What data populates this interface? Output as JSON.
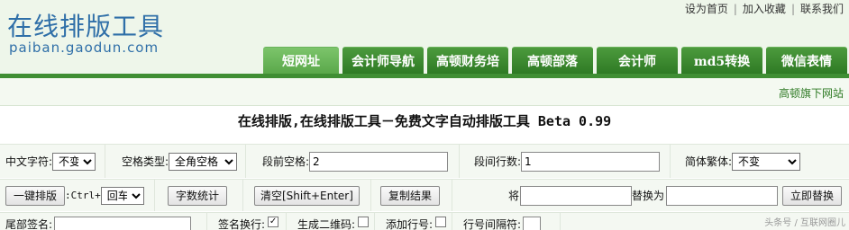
{
  "header": {
    "logo_cn": "在线排版工具",
    "logo_en": "paiban.gaodun.com",
    "top_links": [
      "设为首页",
      "加入收藏",
      "联系我们"
    ],
    "nav_tabs": [
      "短网址",
      "会计师导航",
      "高顿财务培",
      "高顿部落",
      "会计师",
      "md5转换",
      "微信表情"
    ],
    "sub_link": "高顿旗下网站"
  },
  "page_title": "在线排版,在线排版工具－免费文字自动排版工具 Beta 0.99",
  "row1": {
    "chinese_char_label": "中文字符:",
    "chinese_char_value": "不变",
    "space_type_label": "空格类型:",
    "space_type_value": "全角空格",
    "para_space_label": "段前空格:",
    "para_space_value": "2",
    "para_gap_label": "段间行数:",
    "para_gap_value": "1",
    "trad_simp_label": "简体繁体:",
    "trad_simp_value": "不变"
  },
  "row2": {
    "one_key_label": "一键排版",
    "shortcut_label": ":Ctrl+",
    "shortcut_value": "回车",
    "count_label": "字数统计",
    "clear_label": "清空[Shift+Enter]",
    "copy_label": "复制结果",
    "find_label": "将",
    "find_value": "",
    "replace_label": "替换为",
    "replace_value": "",
    "replace_btn": "立即替换"
  },
  "row3": {
    "tail_sign_label": "尾部签名:",
    "sign_wrap_label": "签名换行:",
    "qrcode_label": "生成二维码:",
    "line_no_label": "添加行号:",
    "line_gap_label": "行号间隔符:"
  },
  "watermark": "头条号 / 互联网圈儿"
}
